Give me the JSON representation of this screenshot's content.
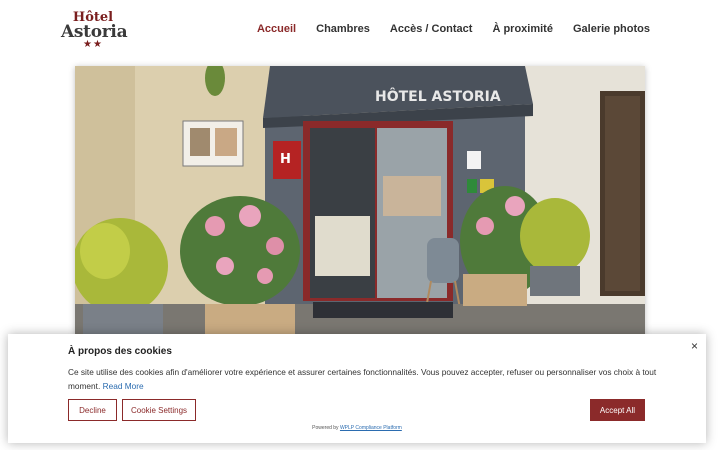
{
  "logo": {
    "line1": "Hôtel",
    "line2": "Astoria",
    "stars": "★★"
  },
  "nav": {
    "items": [
      {
        "label": "Accueil"
      },
      {
        "label": "Chambres"
      },
      {
        "label": "Accès / Contact"
      },
      {
        "label": "À proximité"
      },
      {
        "label": "Galerie photos"
      }
    ]
  },
  "hero": {
    "sign_text": "HÔTEL ASTORIA"
  },
  "cookie": {
    "title": "À propos des cookies",
    "close": "×",
    "description": "Ce site utilise des cookies afin d'améliorer votre expérience et assurer certaines fonctionnalités. Vous pouvez accepter, refuser ou personnaliser vos choix à tout moment.",
    "read_more": "Read More",
    "decline_label": "Decline",
    "settings_label": "Cookie Settings",
    "accept_label": "Accept All",
    "powered_prefix": "Powered by",
    "powered_link": "WPLP Compliance Platform"
  },
  "colors": {
    "brand": "#8b2a2a",
    "text": "#333333",
    "link": "#2b6cb0"
  }
}
